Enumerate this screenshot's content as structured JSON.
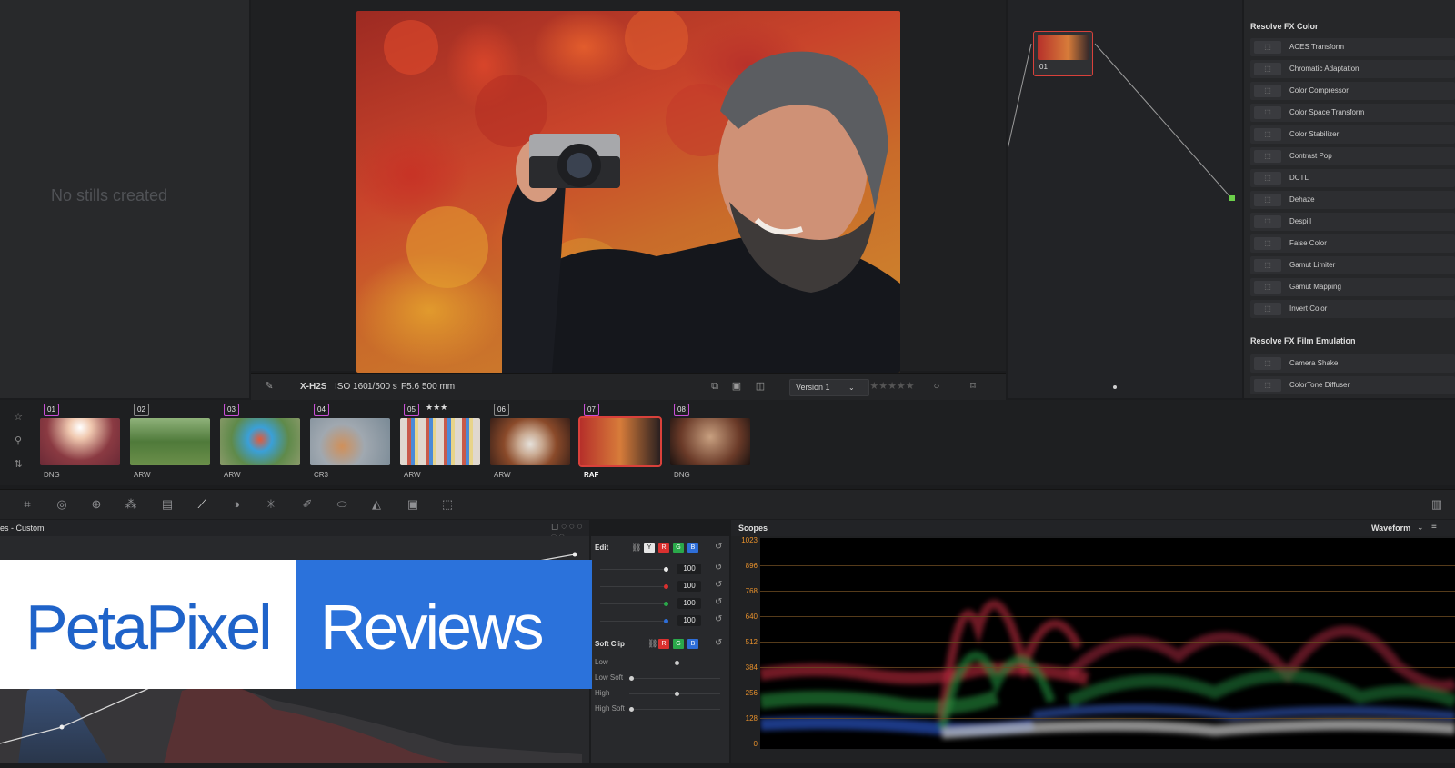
{
  "gallery": {
    "empty_text": "No stills created"
  },
  "viewer_toolbar": {
    "camera": "X-H2S",
    "iso": "ISO 160",
    "shutter": "1/500 s",
    "aperture": "F5.6",
    "focal": "500 mm",
    "version": "Version 1"
  },
  "node": {
    "label": "01"
  },
  "fx_library": {
    "color_heading": "Resolve FX Color",
    "color_items": [
      "ACES Transform",
      "Chromatic Adaptation",
      "Color Compressor",
      "Color Space Transform",
      "Color Stabilizer",
      "Contrast Pop",
      "DCTL",
      "Dehaze",
      "Despill",
      "False Color",
      "Gamut Limiter",
      "Gamut Mapping",
      "Invert Color"
    ],
    "film_heading": "Resolve FX Film Emulation",
    "film_items": [
      "Camera Shake",
      "ColorTone Diffuser"
    ]
  },
  "timeline": {
    "clips": [
      {
        "num": "01",
        "codec": "DNG",
        "color": "#c94fd6",
        "rating": ""
      },
      {
        "num": "02",
        "codec": "ARW",
        "color": "#8a8a8a",
        "rating": ""
      },
      {
        "num": "03",
        "codec": "ARW",
        "color": "#c94fd6",
        "rating": ""
      },
      {
        "num": "04",
        "codec": "CR3",
        "color": "#c94fd6",
        "rating": ""
      },
      {
        "num": "05",
        "codec": "ARW",
        "color": "#c94fd6",
        "rating": "★★★"
      },
      {
        "num": "06",
        "codec": "ARW",
        "color": "#8a8a8a",
        "rating": ""
      },
      {
        "num": "07",
        "codec": "RAF",
        "color": "#c94fd6",
        "rating": ""
      },
      {
        "num": "08",
        "codec": "DNG",
        "color": "#c94fd6",
        "rating": ""
      }
    ]
  },
  "curves": {
    "title": "es - Custom"
  },
  "edit_panel": {
    "edit_label": "Edit",
    "channels": [
      "Y",
      "R",
      "G",
      "B"
    ],
    "values": [
      "100",
      "100",
      "100",
      "100"
    ],
    "soft_clip_label": "Soft Clip",
    "soft_rows": [
      "Low",
      "Low Soft",
      "High",
      "High Soft"
    ]
  },
  "scopes": {
    "title": "Scopes",
    "mode": "Waveform",
    "y_ticks": [
      "1023",
      "896",
      "768",
      "640",
      "512",
      "384",
      "256",
      "128",
      "0"
    ]
  },
  "logo": {
    "left": "PetaPixel",
    "right": "Reviews"
  },
  "colors": {
    "accent_red": "#d9413b",
    "scope_orange": "#e8912c",
    "logo_blue": "#2b72db",
    "logo_text_blue": "#1f63c9"
  }
}
